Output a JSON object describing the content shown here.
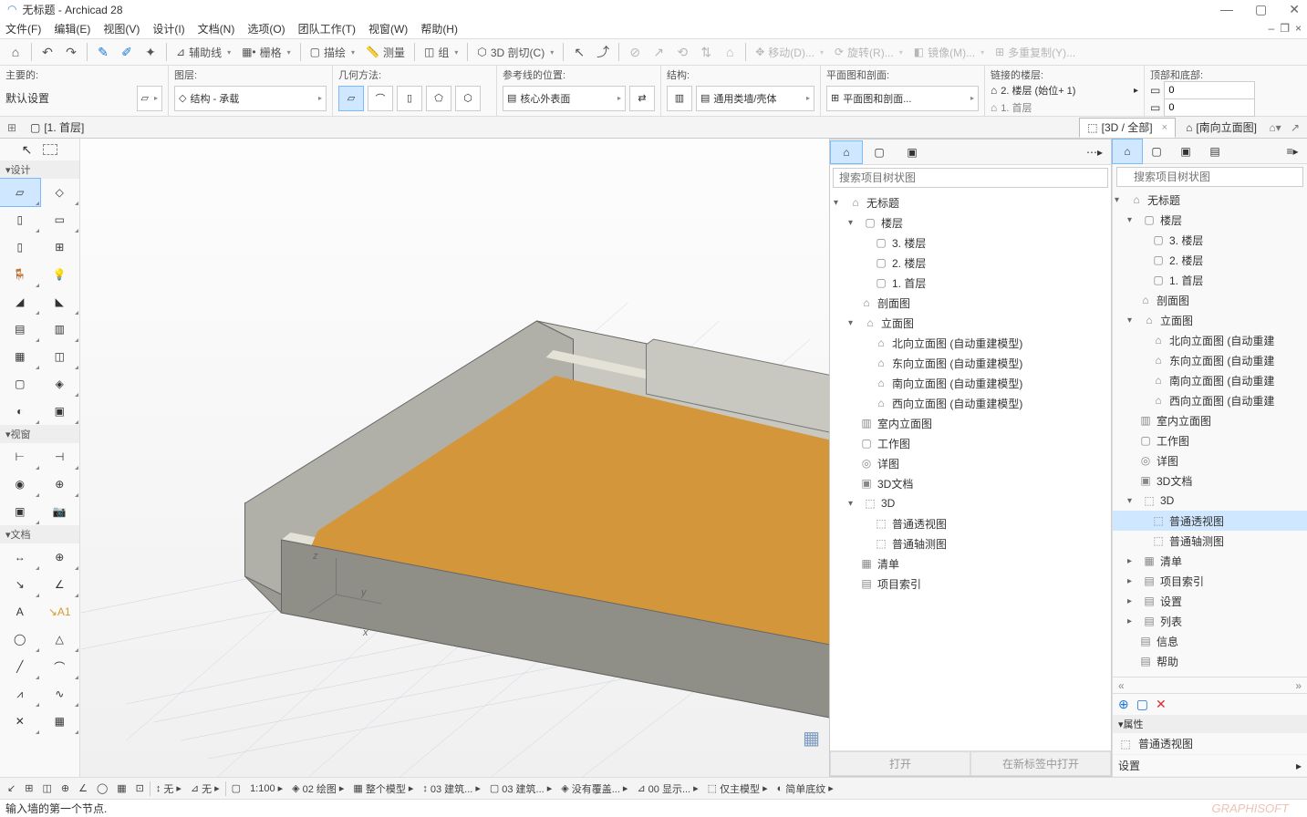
{
  "title": "无标题 - Archicad 28",
  "menu": [
    "文件(F)",
    "编辑(E)",
    "视图(V)",
    "设计(I)",
    "文档(N)",
    "选项(O)",
    "团队工作(T)",
    "视窗(W)",
    "帮助(H)"
  ],
  "toolbar1": {
    "guideline": "辅助线",
    "grid": "栅格",
    "trace": "描绘",
    "measure": "测量",
    "group": "组",
    "cut3d": "3D 剖切(C)",
    "move": "移动(D)...",
    "rotate": "旋转(R)...",
    "mirror": "镜像(M)...",
    "multicopy": "多重复制(Y)..."
  },
  "infobar": {
    "main_label": "主要的:",
    "default_setting": "默认设置",
    "layer_label": "图层:",
    "layer_value": "结构 - 承载",
    "geom_label": "几何方法:",
    "refline_label": "参考线的位置:",
    "refline_value": "核心外表面",
    "struct_label": "结构:",
    "struct_value": "通用类墙/壳体",
    "plan_label": "平面图和剖面:",
    "plan_value": "平面图和剖面...",
    "linked_label": "链接的楼层:",
    "linked_value1": "2. 楼层 (始位+ 1)",
    "linked_value2": "1. 首层",
    "topbot_label": "顶部和底部:",
    "topbot_value1": "0",
    "topbot_value2": "0"
  },
  "tabs": {
    "tab1": "[1. 首层]",
    "tab2": "[3D / 全部]",
    "tab3": "[南向立面图]"
  },
  "toolbox": {
    "design": "设计",
    "viewwin": "视窗",
    "doc": "文档"
  },
  "nav_panel": {
    "search_placeholder": "搜索项目树状图",
    "tree": {
      "root": "无标题",
      "floors_group": "楼层",
      "floors": [
        "3. 楼层",
        "2. 楼层",
        "1. 首层"
      ],
      "sections": "剖面图",
      "elevations_group": "立面图",
      "elevations": [
        "北向立面图 (自动重建模型)",
        "东向立面图 (自动重建模型)",
        "南向立面图 (自动重建模型)",
        "西向立面图 (自动重建模型)"
      ],
      "interior_elev": "室内立面图",
      "worksheet": "工作图",
      "detail": "详图",
      "doc3d": "3D文档",
      "group3d": "3D",
      "perspectives": [
        "普通透视图",
        "普通轴测图"
      ],
      "schedule": "清单",
      "proj_index": "项目索引"
    },
    "btn_open": "打开",
    "btn_open_new": "在新标签中打开"
  },
  "right_panel": {
    "search_placeholder": "搜索项目树状图",
    "root": "无标题",
    "floors_group": "楼层",
    "floors": [
      "3. 楼层",
      "2. 楼层",
      "1. 首层"
    ],
    "sections": "剖面图",
    "elevations_group": "立面图",
    "elevations": [
      "北向立面图 (自动重建",
      "东向立面图 (自动重建",
      "南向立面图 (自动重建",
      "西向立面图 (自动重建"
    ],
    "interior_elev": "室内立面图",
    "worksheet": "工作图",
    "detail": "详图",
    "doc3d": "3D文档",
    "group3d": "3D",
    "perspectives": [
      "普通透视图",
      "普通轴测图"
    ],
    "schedule": "清单",
    "proj_index": "项目索引",
    "settings": "设置",
    "lists": "列表",
    "info": "信息",
    "help": "帮助",
    "props_head": "属性",
    "prop_name": "普通透视图",
    "prop_setting": "设置"
  },
  "status2": {
    "none": "无",
    "scale": "1:100",
    "layer_combo": "02 绘图",
    "model": "整个模型",
    "building": "03 建筑...",
    "building2": "03 建筑...",
    "no_override": "没有覆盖...",
    "display": "00 显示...",
    "only_model": "仅主模型",
    "simple": "简单底纹"
  },
  "status3": "输入墙的第一个节点.",
  "watermark": "GRAPHISOFT"
}
